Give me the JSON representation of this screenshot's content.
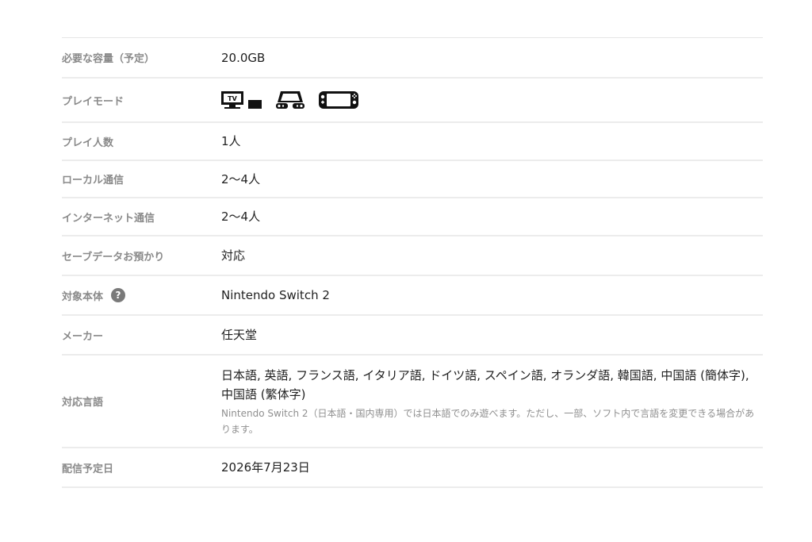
{
  "specs": {
    "size": {
      "label": "必要な容量（予定）",
      "value": "20.0GB"
    },
    "play_mode": {
      "label": "プレイモード",
      "modes": [
        {
          "icon": "tv-mode-icon",
          "tv_text": "TV"
        },
        {
          "icon": "tabletop-mode-icon"
        },
        {
          "icon": "handheld-mode-icon"
        }
      ]
    },
    "players": {
      "label": "プレイ人数",
      "value": "1人"
    },
    "local": {
      "label": "ローカル通信",
      "value": "2～4人"
    },
    "online": {
      "label": "インターネット通信",
      "value": "2～4人"
    },
    "save": {
      "label": "セーブデータお預かり",
      "value": "対応"
    },
    "target": {
      "label": "対象本体",
      "help_icon": "?",
      "value": "Nintendo Switch 2"
    },
    "maker": {
      "label": "メーカー",
      "value": "任天堂"
    },
    "languages": {
      "label": "対応言語",
      "value": "日本語, 英語, フランス語, イタリア語, ドイツ語, スペイン語, オランダ語, 韓国語, 中国語 (簡体字), 中国語 (繁体字)",
      "note": "Nintendo Switch 2（日本語・国内専用）では日本語でのみ遊べます。ただし、一部、ソフト内で言語を変更できる場合があります。"
    },
    "release": {
      "label": "配信予定日",
      "value": "2026年7月23日"
    }
  }
}
